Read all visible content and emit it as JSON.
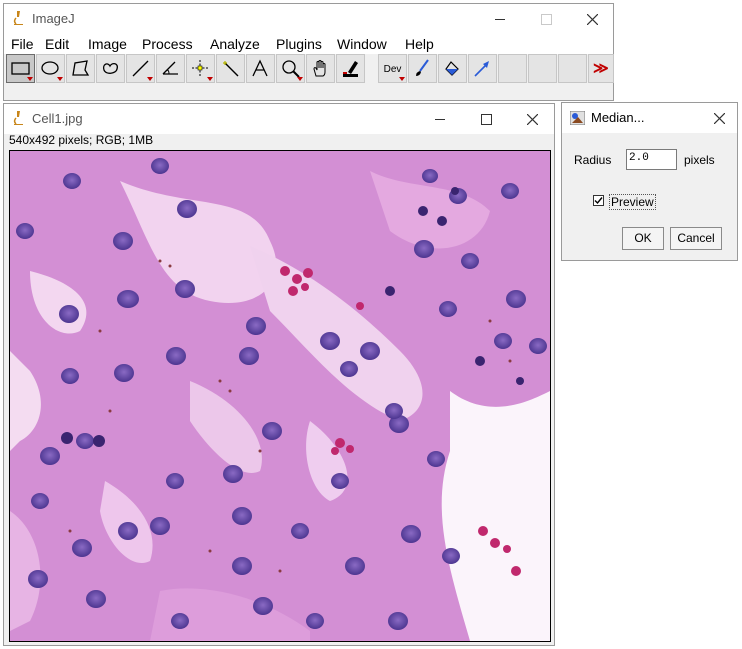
{
  "main_window": {
    "title": "ImageJ",
    "menu": [
      "File",
      "Edit",
      "Image",
      "Process",
      "Analyze",
      "Plugins",
      "Window",
      "Help"
    ],
    "tools": [
      {
        "name": "rectangle-tool-icon"
      },
      {
        "name": "oval-tool-icon"
      },
      {
        "name": "polygon-tool-icon"
      },
      {
        "name": "freehand-tool-icon"
      },
      {
        "name": "line-tool-icon"
      },
      {
        "name": "angle-tool-icon"
      },
      {
        "name": "point-tool-icon"
      },
      {
        "name": "wand-tool-icon"
      },
      {
        "name": "text-tool-icon",
        "glyph": "A"
      },
      {
        "name": "magnifier-tool-icon"
      },
      {
        "name": "hand-tool-icon"
      },
      {
        "name": "color-picker-tool-icon"
      },
      {
        "name": "developer-menu-icon",
        "label": "Dev"
      },
      {
        "name": "brush-tool-icon"
      },
      {
        "name": "flood-fill-tool-icon"
      },
      {
        "name": "arrow-tool-icon"
      },
      {
        "name": "more-tools-icon",
        "glyph": "≫"
      }
    ]
  },
  "image_window": {
    "title": "Cell1.jpg",
    "info": "540x492 pixels; RGB; 1MB"
  },
  "median_dialog": {
    "title": "Median...",
    "radius_label": "Radius",
    "radius_value": "2.0",
    "radius_unit": "pixels",
    "preview_label": "Preview",
    "preview_checked": true,
    "ok_label": "OK",
    "cancel_label": "Cancel"
  },
  "colors": {
    "accent_red": "#c00000",
    "tissue_pink": "#d889d2",
    "nucleus_purple": "#6a4aa8"
  }
}
